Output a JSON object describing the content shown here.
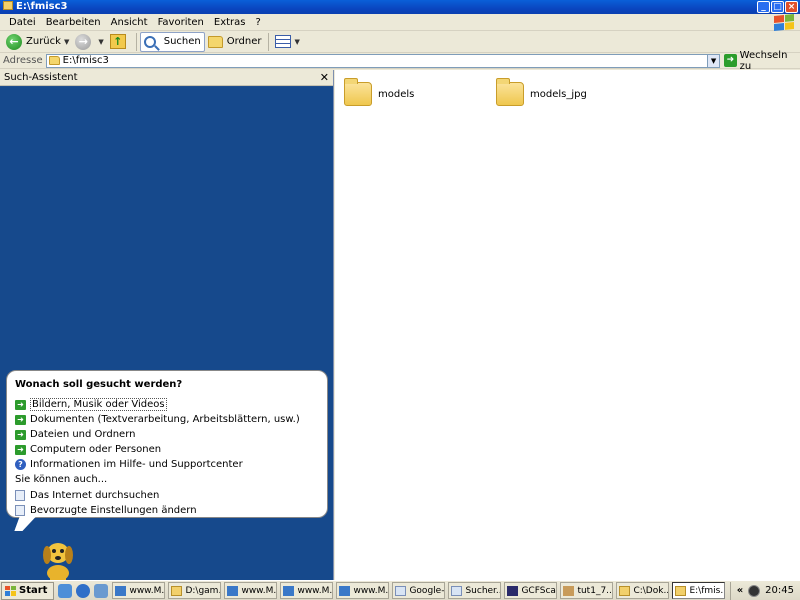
{
  "window": {
    "title": "E:\\fmisc3"
  },
  "menu": [
    "Datei",
    "Bearbeiten",
    "Ansicht",
    "Favoriten",
    "Extras",
    "?"
  ],
  "toolbar": {
    "back_label": "Zurück",
    "search_label": "Suchen",
    "folders_label": "Ordner"
  },
  "address": {
    "label": "Adresse",
    "value": "E:\\fmisc3",
    "go_label": "Wechseln zu"
  },
  "search_pane": {
    "title": "Such-Assistent",
    "question": "Wonach soll gesucht werden?",
    "options": [
      "Bildern, Musik oder Videos",
      "Dokumenten (Textverarbeitung, Arbeitsblättern, usw.)",
      "Dateien und Ordnern",
      "Computern oder Personen",
      "Informationen im Hilfe- und Supportcenter"
    ],
    "also_label": "Sie können auch...",
    "extra_options": [
      "Das Internet durchsuchen",
      "Bevorzugte Einstellungen ändern"
    ]
  },
  "files": [
    {
      "name": "models",
      "icon": "folder-icon"
    },
    {
      "name": "models_jpg",
      "icon": "folder-icon"
    }
  ],
  "taskbar": {
    "start_label": "Start",
    "tasks": [
      "www.M...",
      "D:\\gam...",
      "www.M...",
      "www.M...",
      "www.M...",
      "Google-...",
      "Sucher...",
      "GCFSca...",
      "tut1_7....",
      "C:\\Dok...",
      "E:\\fmis..."
    ],
    "time": "20:45"
  },
  "colors": {
    "titlebar": "#0a46c0",
    "pane_blue": "#16498c",
    "go_green": "#2b9d2b"
  }
}
